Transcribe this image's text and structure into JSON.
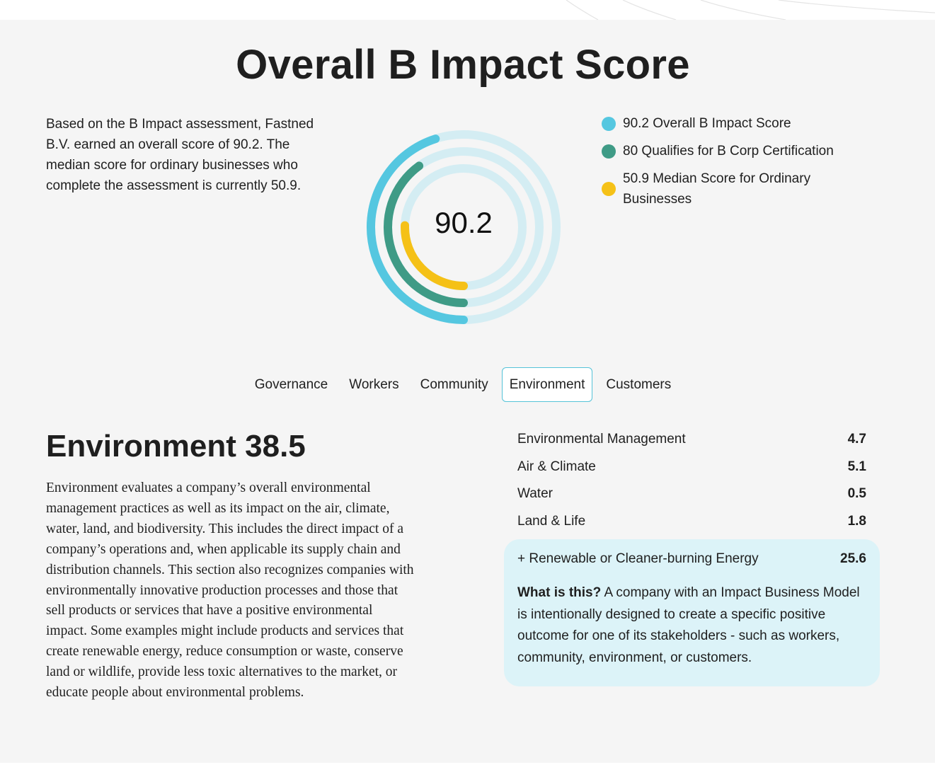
{
  "header": {
    "title": "Overall B Impact Score"
  },
  "intro": "Based on the B Impact assessment, Fastned B.V. earned an overall score of 90.2. The median score for ordinary businesses who complete the assessment is currently 50.9.",
  "score_ring": {
    "center_value": "90.2",
    "max_score": 200,
    "rings": [
      {
        "name": "overall",
        "value": 90.2,
        "color": "#55c7e0"
      },
      {
        "name": "certification",
        "value": 80,
        "color": "#3f9b86"
      },
      {
        "name": "median",
        "value": 50.9,
        "color": "#f5c117"
      }
    ],
    "track_color": "#d4edf3"
  },
  "legend": [
    {
      "text": "90.2 Overall B Impact Score",
      "color": "#55c7e0"
    },
    {
      "text": "80 Qualifies for B Corp Certification",
      "color": "#3f9b86"
    },
    {
      "text": "50.9 Median Score for Ordinary Businesses",
      "color": "#f5c117"
    }
  ],
  "tabs": [
    {
      "label": "Governance",
      "active": false
    },
    {
      "label": "Workers",
      "active": false
    },
    {
      "label": "Community",
      "active": false
    },
    {
      "label": "Environment",
      "active": true
    },
    {
      "label": "Customers",
      "active": false
    }
  ],
  "section": {
    "title": "Environment 38.5",
    "description": "Environment evaluates a company’s overall environmental management practices as well as its impact on the air, climate, water, land, and biodiversity. This includes the direct impact of a company’s operations and, when applicable its supply chain and distribution channels. This section also recognizes companies with environmentally innovative production processes and those that sell products or services that have a positive environmental impact. Some examples might include products and services that create renewable energy, reduce consumption or waste, conserve land or wildlife, provide less toxic alternatives to the market, or educate people about environmental problems."
  },
  "metrics": [
    {
      "label": "Environmental Management",
      "value": "4.7"
    },
    {
      "label": "Air & Climate",
      "value": "5.1"
    },
    {
      "label": "Water",
      "value": "0.5"
    },
    {
      "label": "Land & Life",
      "value": "1.8"
    }
  ],
  "impact_box": {
    "label": "+ Renewable or Cleaner-burning Energy",
    "value": "25.6",
    "question": "What is this?",
    "explanation": "A company with an Impact Business Model is intentionally designed to create a specific positive outcome for one of its stakeholders - such as workers, community, environment, or customers."
  }
}
